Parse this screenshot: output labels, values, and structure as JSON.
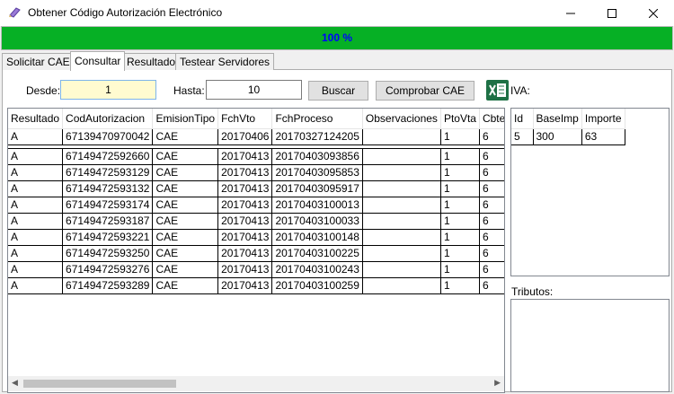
{
  "window": {
    "title": "Obtener Código Autorización Electrónico",
    "minimize": "—",
    "maximize": "☐",
    "close": "✕"
  },
  "progress": {
    "text": "100 %",
    "value": 1.0
  },
  "tabs": [
    {
      "label": "Solicitar CAE"
    },
    {
      "label": "Consultar"
    },
    {
      "label": "Resultado"
    },
    {
      "label": "Testear Servidores"
    }
  ],
  "form": {
    "desde_label": "Desde:",
    "desde_value": "1",
    "hasta_label": "Hasta:",
    "hasta_value": "10",
    "buscar_label": "Buscar",
    "comprobar_label": "Comprobar CAE",
    "iva_label": "IVA:",
    "tributos_label": "Tributos:"
  },
  "main_grid": {
    "columns": [
      "Resultado",
      "CodAutorizacion",
      "EmisionTipo",
      "FchVto",
      "FchProceso",
      "Observaciones",
      "PtoVta",
      "CbteTipo"
    ],
    "rows": [
      [
        "A",
        "67139470970042",
        "CAE",
        "20170406",
        "20170327124205",
        "",
        "1",
        "6"
      ],
      [
        "A",
        "67149472592660",
        "CAE",
        "20170413",
        "20170403093856",
        "",
        "1",
        "6"
      ],
      [
        "A",
        "67149472593129",
        "CAE",
        "20170413",
        "20170403095853",
        "",
        "1",
        "6"
      ],
      [
        "A",
        "67149472593132",
        "CAE",
        "20170413",
        "20170403095917",
        "",
        "1",
        "6"
      ],
      [
        "A",
        "67149472593174",
        "CAE",
        "20170413",
        "20170403100013",
        "",
        "1",
        "6"
      ],
      [
        "A",
        "67149472593187",
        "CAE",
        "20170413",
        "20170403100033",
        "",
        "1",
        "6"
      ],
      [
        "A",
        "67149472593221",
        "CAE",
        "20170413",
        "20170403100148",
        "",
        "1",
        "6"
      ],
      [
        "A",
        "67149472593250",
        "CAE",
        "20170413",
        "20170403100225",
        "",
        "1",
        "6"
      ],
      [
        "A",
        "67149472593276",
        "CAE",
        "20170413",
        "20170403100243",
        "",
        "1",
        "6"
      ],
      [
        "A",
        "67149472593289",
        "CAE",
        "20170413",
        "20170403100259",
        "",
        "1",
        "6"
      ]
    ]
  },
  "iva_grid": {
    "columns": [
      "Id",
      "BaseImp",
      "Importe"
    ],
    "rows": [
      [
        "5",
        "300",
        "63"
      ]
    ]
  }
}
